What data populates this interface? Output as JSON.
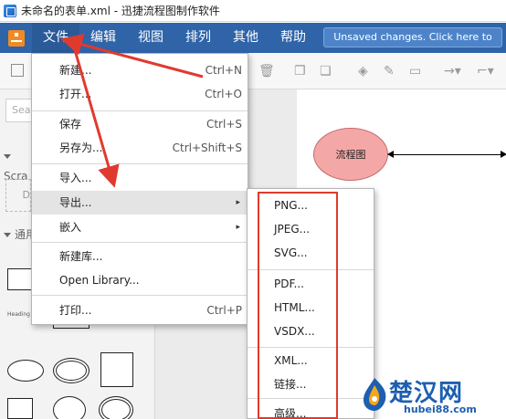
{
  "window": {
    "title": "未命名的表单.xml - 迅捷流程图制作软件"
  },
  "menubar": {
    "items": [
      "文件",
      "编辑",
      "视图",
      "排列",
      "其他",
      "帮助"
    ],
    "unsaved_notice": "Unsaved changes. Click here to save."
  },
  "sidebar": {
    "search_placeholder": "Sea",
    "section_scratchpad": "Scra",
    "scratch_box_label": "D",
    "section_general": "通用",
    "heading_thumb": "Heading"
  },
  "canvas": {
    "node_label": "流程图"
  },
  "file_menu": {
    "items": [
      {
        "label": "新建...",
        "shortcut": "Ctrl+N"
      },
      {
        "label": "打开...",
        "shortcut": "Ctrl+O"
      },
      {
        "label": "保存",
        "shortcut": "Ctrl+S"
      },
      {
        "label": "另存为...",
        "shortcut": "Ctrl+Shift+S"
      },
      {
        "label": "导入...",
        "shortcut": ""
      },
      {
        "label": "导出...",
        "shortcut": "",
        "submenu": "▸"
      },
      {
        "label": "嵌入",
        "shortcut": "",
        "submenu": "▸"
      },
      {
        "label": "新建库...",
        "shortcut": ""
      },
      {
        "label": "Open Library...",
        "shortcut": ""
      },
      {
        "label": "打印...",
        "shortcut": "Ctrl+P"
      }
    ]
  },
  "export_menu": {
    "items": [
      "PNG...",
      "JPEG...",
      "SVG...",
      "PDF...",
      "HTML...",
      "VSDX...",
      "XML...",
      "链接...",
      "高级..."
    ]
  },
  "watermark": {
    "brand": "楚汉网",
    "url": "hubei88.com"
  },
  "colors": {
    "menubar": "#2f64a8",
    "node_fill": "#f4a7a7",
    "annotation_red": "#e03a2e",
    "watermark_blue": "#1d5fb0"
  }
}
